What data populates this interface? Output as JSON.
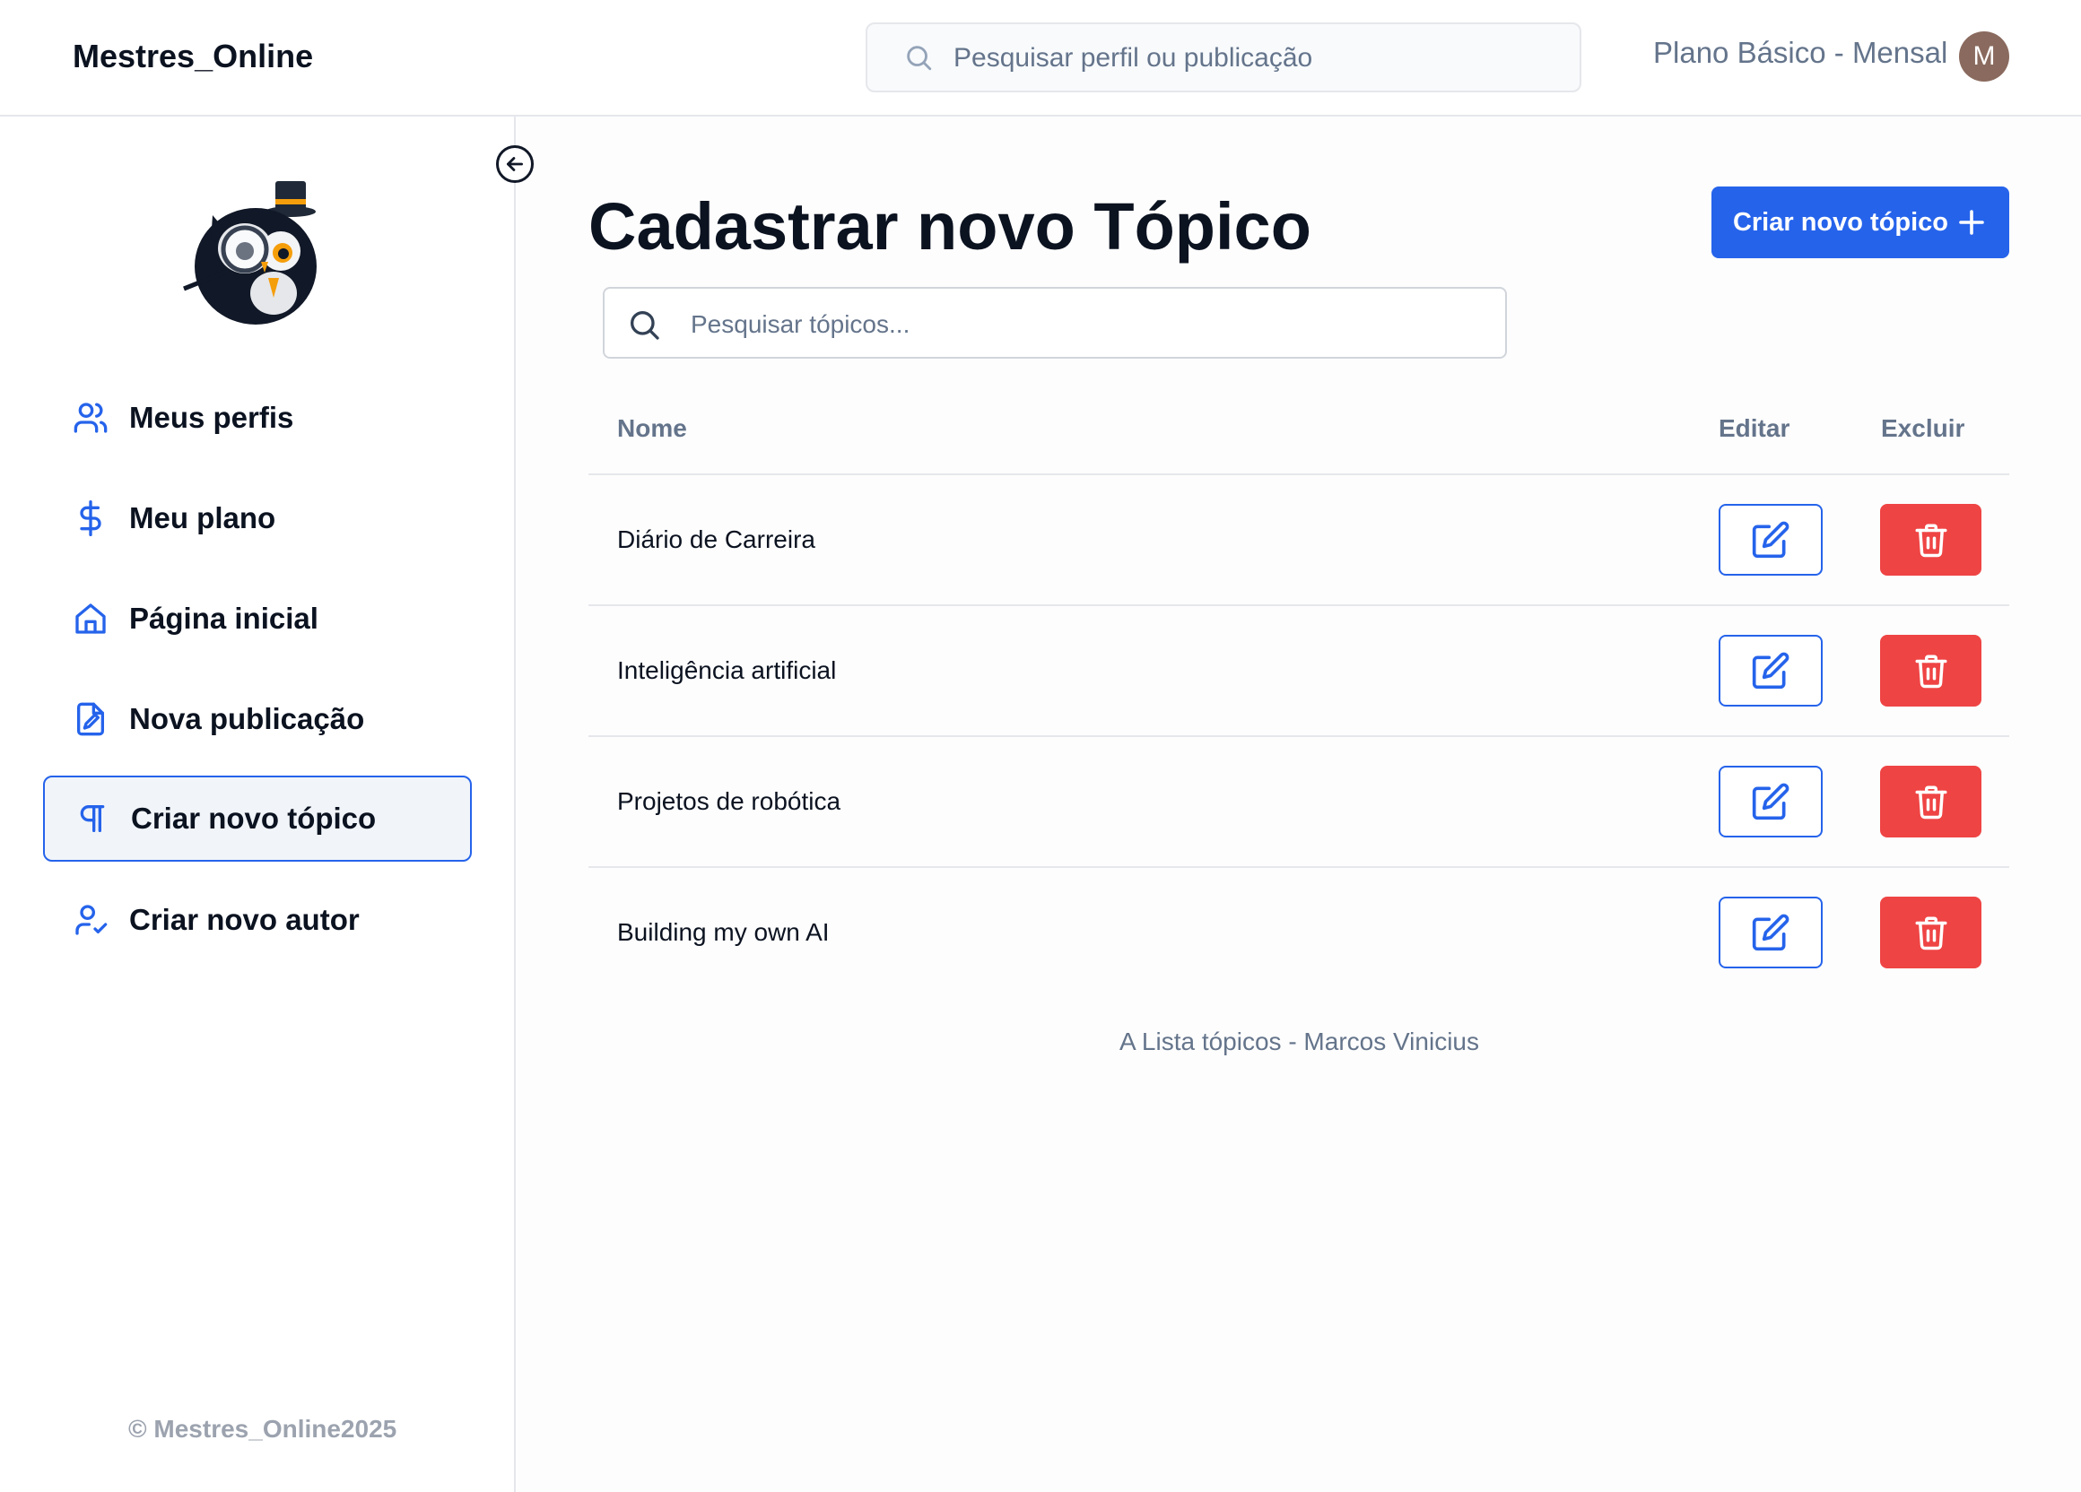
{
  "header": {
    "app_title": "Mestres_Online",
    "search_placeholder": "Pesquisar perfil ou publicação",
    "plan_label": "Plano Básico - Mensal",
    "avatar_initial": "M"
  },
  "sidebar": {
    "items": [
      {
        "label": "Meus perfis",
        "icon": "users-icon"
      },
      {
        "label": "Meu plano",
        "icon": "dollar-icon"
      },
      {
        "label": "Página inicial",
        "icon": "home-icon"
      },
      {
        "label": "Nova publicação",
        "icon": "file-edit-icon"
      },
      {
        "label": "Criar novo tópico",
        "icon": "pilcrow-icon",
        "active": true
      },
      {
        "label": "Criar novo autor",
        "icon": "user-check-icon"
      }
    ],
    "footer": "© Mestres_Online2025"
  },
  "main": {
    "title": "Cadastrar novo Tópico",
    "create_button_label": "Criar novo tópico",
    "search_placeholder": "Pesquisar tópicos...",
    "columns": {
      "name": "Nome",
      "edit": "Editar",
      "delete": "Excluir"
    },
    "topics": [
      {
        "name": "Diário de Carreira"
      },
      {
        "name": "Inteligência artificial"
      },
      {
        "name": "Projetos de robótica"
      },
      {
        "name": "Building my own AI"
      }
    ],
    "footer": "A Lista tópicos - Marcos Vinicius"
  },
  "colors": {
    "accent": "#2563eb",
    "danger": "#ef4444",
    "muted": "#64748b"
  }
}
